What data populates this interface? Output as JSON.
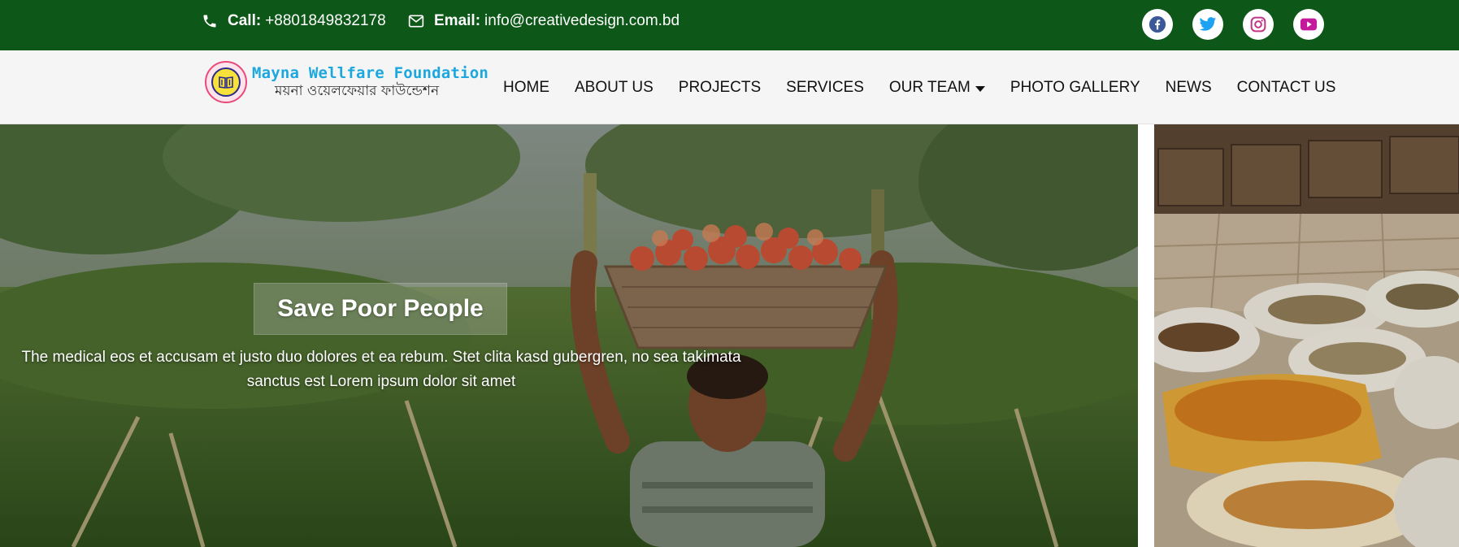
{
  "topbar": {
    "call_label": "Call:",
    "call_number": "+8801849832178",
    "email_label": "Email:",
    "email_address": "info@creativedesign.com.bd",
    "socials": [
      {
        "icon": "facebook-icon",
        "color": "#3b5998"
      },
      {
        "icon": "twitter-icon",
        "color": "#1da1f2"
      },
      {
        "icon": "instagram-icon",
        "color": "#c13584"
      },
      {
        "icon": "youtube-icon",
        "color": "#c4199a"
      }
    ],
    "background": "#0d5718"
  },
  "brand": {
    "name": "Mayna Wellfare Foundation",
    "name_bn": "ময়না ওয়েলফেয়ার ফাউন্ডেশন",
    "name_color": "#1ca8df"
  },
  "nav": {
    "items": [
      {
        "label": "HOME"
      },
      {
        "label": "ABOUT US"
      },
      {
        "label": "PROJECTS"
      },
      {
        "label": "SERVICES"
      },
      {
        "label": "OUR TEAM"
      },
      {
        "label": "PHOTO GALLERY"
      },
      {
        "label": "NEWS"
      },
      {
        "label": "CONTACT US"
      }
    ]
  },
  "hero": {
    "title": "Save Poor People",
    "text_line1": "The medical eos et accusam et justo duo dolores et ea rebum. Stet clita kasd gubergren, no sea takimata",
    "text_line2": "sanctus est Lorem ipsum dolor sit amet"
  }
}
